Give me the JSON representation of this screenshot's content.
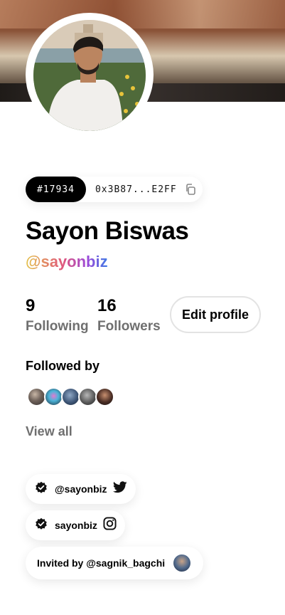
{
  "profile": {
    "token_id": "#17934",
    "wallet_address": "0x3B87...E2FF",
    "name": "Sayon Biswas",
    "handle": "@sayonbiz"
  },
  "stats": {
    "following_count": "9",
    "following_label": "Following",
    "followers_count": "16",
    "followers_label": "Followers"
  },
  "actions": {
    "edit_profile_label": "Edit profile"
  },
  "followed_by": {
    "title": "Followed by",
    "view_all_label": "View all",
    "avatar_count": 5
  },
  "socials": {
    "twitter_handle": "@sayonbiz",
    "instagram_handle": "sayonbiz",
    "invited_by": "Invited by @sagnik_bagchi"
  },
  "icons": {
    "copy": "copy-icon",
    "verified": "verified-badge-icon",
    "twitter": "twitter-icon",
    "instagram": "instagram-icon"
  },
  "colors": {
    "handle_gradient": [
      "#e3c24a",
      "#e0567b",
      "#9c4ad9",
      "#3e7ce5"
    ],
    "muted_text": "#6f6f6f",
    "id_pill_bg": "#000000"
  }
}
